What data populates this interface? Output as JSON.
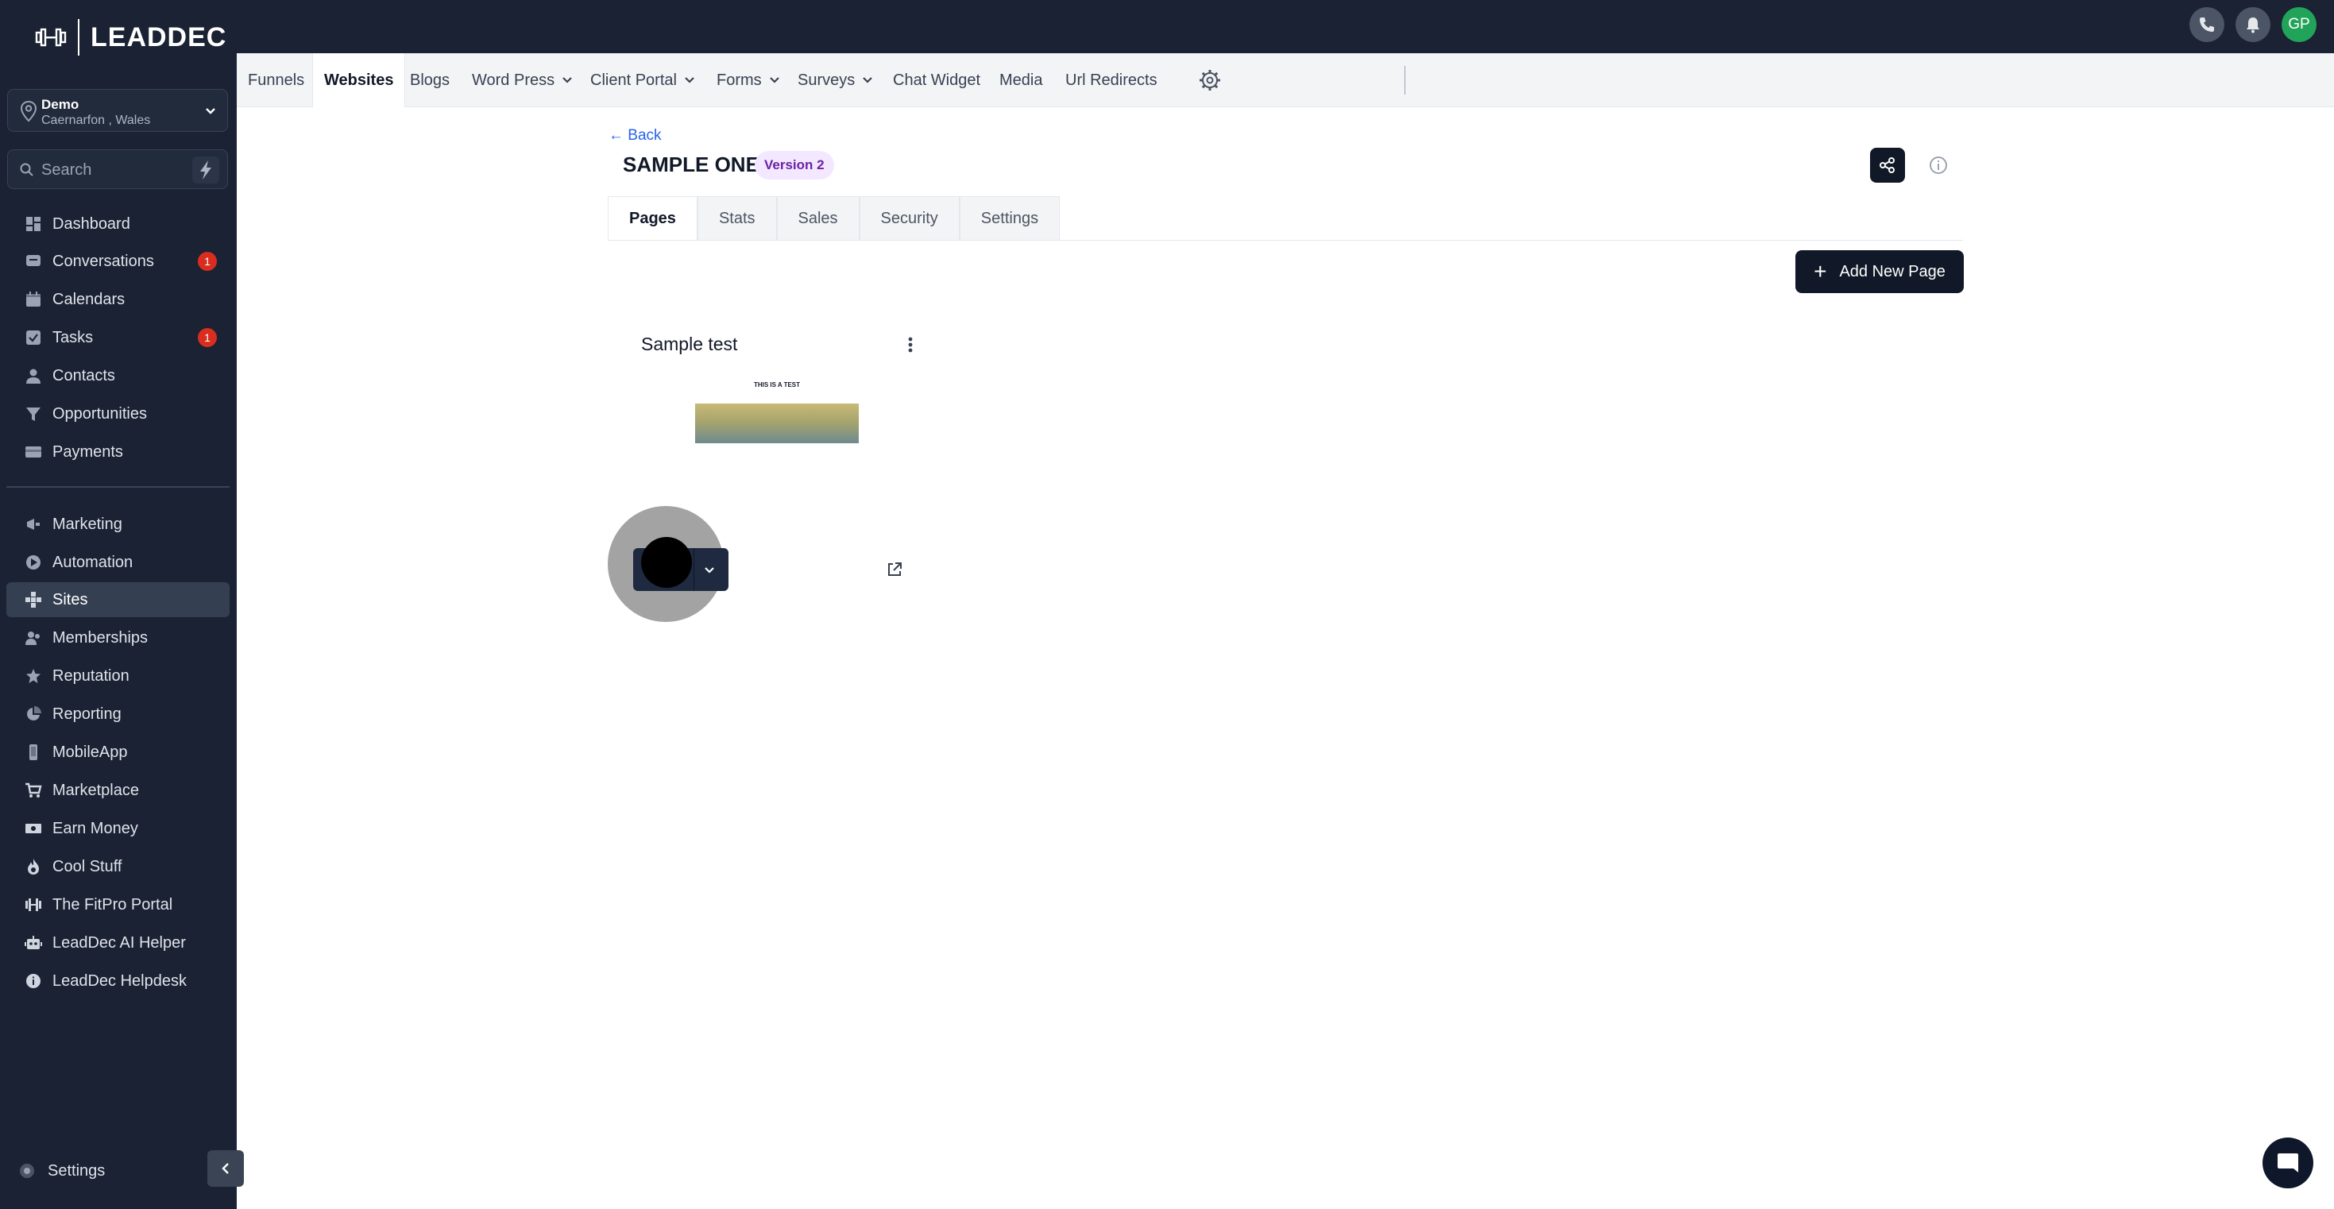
{
  "brand": {
    "name": "LEADDEC"
  },
  "location": {
    "name": "Demo",
    "address": "Caernarfon , Wales"
  },
  "search": {
    "placeholder": "Search"
  },
  "sidebar": {
    "items": [
      {
        "label": "Dashboard"
      },
      {
        "label": "Conversations",
        "badge": "1"
      },
      {
        "label": "Calendars"
      },
      {
        "label": "Tasks",
        "badge": "1"
      },
      {
        "label": "Contacts"
      },
      {
        "label": "Opportunities"
      },
      {
        "label": "Payments"
      },
      {
        "label": "Marketing"
      },
      {
        "label": "Automation"
      },
      {
        "label": "Sites",
        "active": true
      },
      {
        "label": "Memberships"
      },
      {
        "label": "Reputation"
      },
      {
        "label": "Reporting"
      },
      {
        "label": "MobileApp"
      },
      {
        "label": "Marketplace"
      },
      {
        "label": "Earn Money"
      },
      {
        "label": "Cool Stuff"
      },
      {
        "label": "The FitPro Portal"
      },
      {
        "label": "LeadDec AI Helper"
      },
      {
        "label": "LeadDec Helpdesk"
      }
    ],
    "settings_label": "Settings"
  },
  "topbar": {
    "avatar_initials": "GP"
  },
  "subnav": {
    "items": [
      {
        "label": "Funnels"
      },
      {
        "label": "Websites",
        "active": true
      },
      {
        "label": "Blogs"
      },
      {
        "label": "Word Press",
        "dropdown": true
      },
      {
        "label": "Client Portal",
        "dropdown": true
      },
      {
        "label": "Forms",
        "dropdown": true
      },
      {
        "label": "Surveys",
        "dropdown": true
      },
      {
        "label": "Chat Widget"
      },
      {
        "label": "Media"
      },
      {
        "label": "Url Redirects"
      }
    ]
  },
  "main": {
    "back_label": "Back",
    "site_title": "SAMPLE ONE",
    "version_badge": "Version 2",
    "tabs": [
      {
        "label": "Pages",
        "active": true
      },
      {
        "label": "Stats"
      },
      {
        "label": "Sales"
      },
      {
        "label": "Security"
      },
      {
        "label": "Settings"
      }
    ],
    "add_page_label": "Add New Page",
    "pages": [
      {
        "name": "Sample test",
        "thumbnail_text": "THIS IS A TEST"
      }
    ]
  },
  "colors": {
    "sidebar_bg": "#1a2233",
    "active_item": "#353f52",
    "badge": "#d92d20",
    "link": "#2563eb",
    "version_badge_bg": "#f3e8ff",
    "version_badge_fg": "#6b21a8",
    "avatar": "#22a35a",
    "primary_button": "#111827"
  }
}
